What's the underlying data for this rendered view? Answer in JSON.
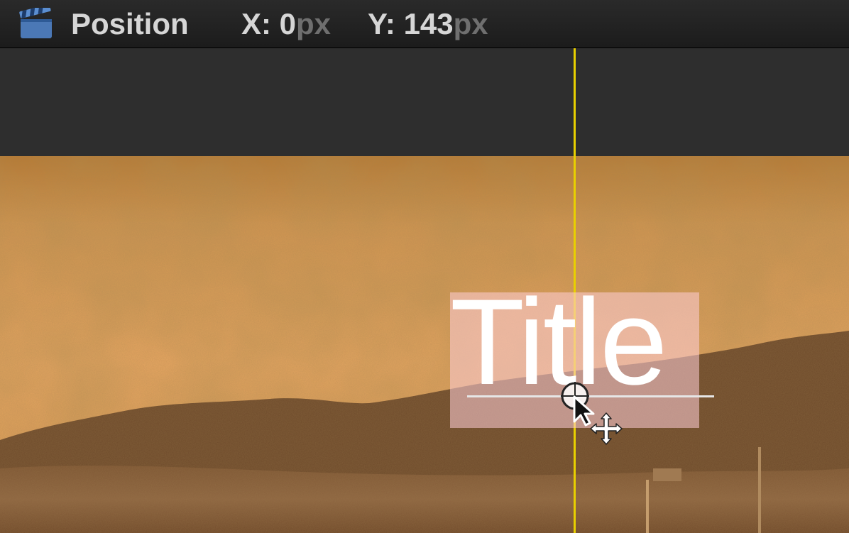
{
  "hud": {
    "icon": "clapperboard-icon",
    "label": "Position",
    "x_label": "X: ",
    "x_value": "0",
    "x_unit": "px",
    "y_label": "Y: ",
    "y_value": "143",
    "y_unit": "px"
  },
  "viewer": {
    "title_text": "Title",
    "guide_color": "#e8d000",
    "selection_color": "#ffcdd7",
    "anchor_icon": "anchor-point-icon",
    "cursor_icon": "arrow-cursor-icon",
    "move_icon": "move-cursor-icon"
  }
}
